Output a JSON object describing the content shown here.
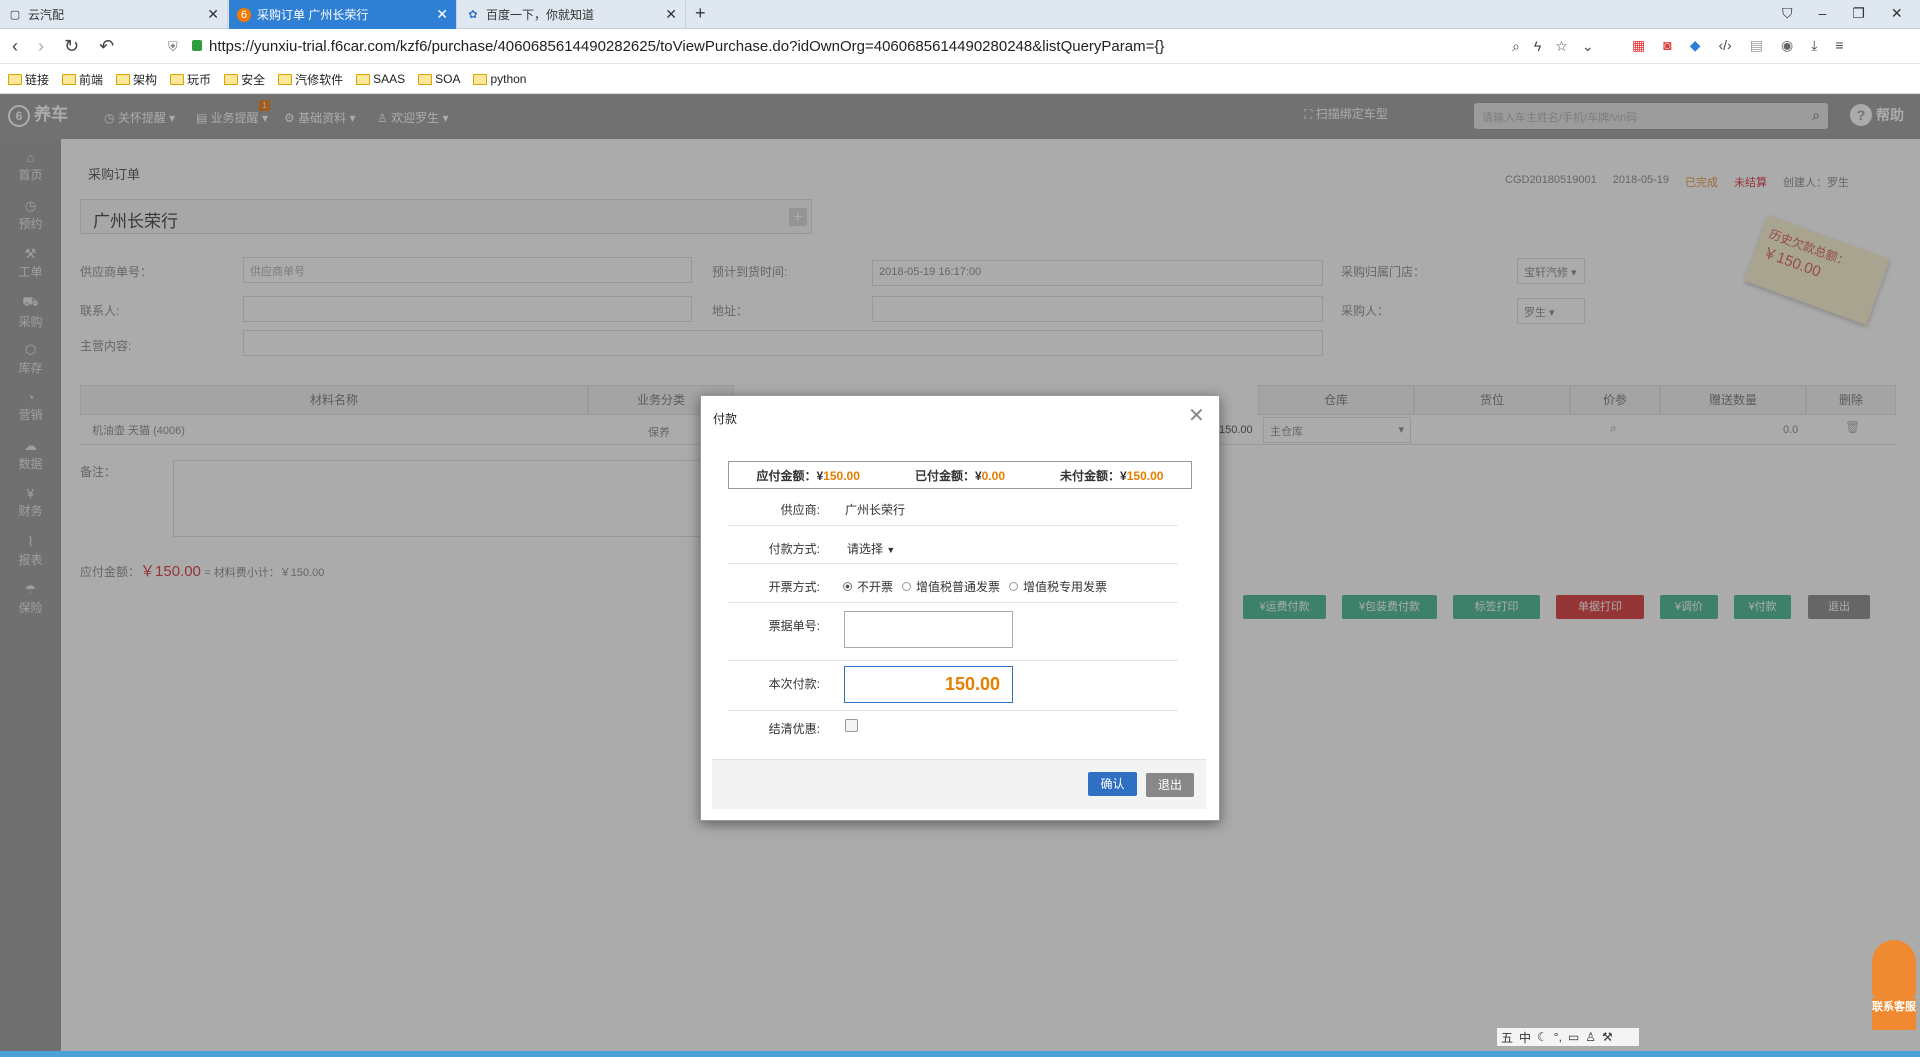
{
  "browser": {
    "tabs": [
      {
        "label": "云汽配",
        "active": false
      },
      {
        "label": "采购订单 广州长荣行",
        "active": true
      },
      {
        "label": "百度一下，你就知道",
        "active": false
      }
    ],
    "url": "https://yunxiu-trial.f6car.com/kzf6/purchase/4060685614490282625/toViewPurchase.do?idOwnOrg=4060685614490280248&listQueryParam={}",
    "bookmarks": [
      "链接",
      "前端",
      "架构",
      "玩币",
      "安全",
      "汽修软件",
      "SAAS",
      "SOA",
      "python"
    ]
  },
  "app": {
    "logo": "养车",
    "nav": [
      "关怀提醒",
      "业务提醒",
      "基础资料",
      "欢迎罗生"
    ],
    "nav_badge": "1",
    "scan_label": "扫描绑定车型",
    "search_placeholder": "请输入车主姓名/手机/车牌/vin码",
    "help": "帮助",
    "sidebar": [
      {
        "label": "首页",
        "icon": "home-icon"
      },
      {
        "label": "预约",
        "icon": "clock-icon"
      },
      {
        "label": "工单",
        "icon": "wrench-icon"
      },
      {
        "label": "采购",
        "icon": "cart-icon"
      },
      {
        "label": "库存",
        "icon": "box-icon"
      },
      {
        "label": "营销",
        "icon": "target-icon"
      },
      {
        "label": "数据",
        "icon": "cloud-icon"
      },
      {
        "label": "财务",
        "icon": "yen-icon"
      },
      {
        "label": "报表",
        "icon": "chart-icon"
      },
      {
        "label": "保险",
        "icon": "umbrella-icon"
      }
    ]
  },
  "page": {
    "breadcrumb": "采购订单",
    "order_no": "CGD20180519001",
    "date": "2018-05-19",
    "status1": "已完成",
    "status2": "未结算",
    "creator": "创建人：罗生",
    "supplier_name": "广州长荣行",
    "stamp": "历史欠款总额：",
    "stamp_amount": "￥150.00",
    "form": {
      "supplier_no_label": "供应商单号：",
      "supplier_no_placeholder": "供应商单号",
      "expected_label": "预计到货时间:",
      "expected_value": "2018-05-19 16:17:00",
      "store_label": "采购归属门店：",
      "store_value": "宝轩汽修",
      "contact_label": "联系人:",
      "address_label": "地址：",
      "buyer_label": "采购人：",
      "buyer_value": "罗生",
      "business_label": "主营内容:"
    },
    "table_headers": [
      "材料名称",
      "业务分类",
      "",
      "",
      "",
      "",
      "仓库",
      "货位",
      "价参",
      "赠送数量",
      "删除"
    ],
    "row": {
      "name": "机油壶 天猫 (4006)",
      "category": "保养",
      "amount": "150.00",
      "warehouse": "主仓库",
      "gift": "0.0"
    },
    "remark_label": "备注：",
    "summary_label": "应付金额：",
    "summary_amount": "￥150.00",
    "summary_rest": "= 材料费小计：￥150.00",
    "buttons": [
      "¥运费付款",
      "¥包装费付款",
      "标签打印",
      "单据打印",
      "¥调价",
      "¥付款",
      "退出"
    ]
  },
  "modal": {
    "title": "付款",
    "payable_label": "应付金额：¥",
    "payable": "150.00",
    "paid_label": "已付金额：¥",
    "paid": "0.00",
    "unpaid_label": "未付金额：¥",
    "unpaid": "150.00",
    "supplier_label": "供应商:",
    "supplier_value": "广州长荣行",
    "method_label": "付款方式:",
    "method_value": "请选择",
    "invoice_label": "开票方式:",
    "invoice_options": [
      "不开票",
      "增值税普通发票",
      "增值税专用发票"
    ],
    "receipt_label": "票据单号:",
    "receipt_value": "",
    "amount_label": "本次付款:",
    "amount_value": "150.00",
    "discount_label": "结清优惠:",
    "confirm": "确认",
    "cancel": "退出"
  },
  "widget": {
    "service": "联系客服",
    "ime": "中"
  },
  "colors": {
    "accent_orange": "#e67e00",
    "primary_blue": "#2f6fc4",
    "tab_active": "#2f7fd4",
    "header_gray": "#a9a9a9"
  }
}
